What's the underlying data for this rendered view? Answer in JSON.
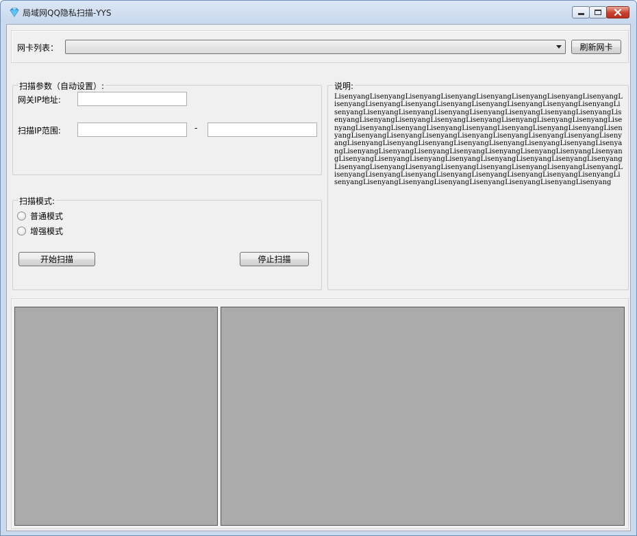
{
  "window": {
    "title": "局域网QQ隐私扫描-YYS"
  },
  "adapter": {
    "label": "网卡列表：",
    "selected": "",
    "refresh_button": "刷新网卡"
  },
  "scan_params": {
    "title": "扫描参数（自动设置）:",
    "gateway_label": "网关IP地址:",
    "gateway_value": "",
    "range_label": "扫描IP范围:",
    "range_start": "",
    "range_sep": "-",
    "range_end": ""
  },
  "scan_mode": {
    "title": "扫描模式:",
    "options": [
      "普通模式",
      "增强模式"
    ],
    "start_button": "开始扫描",
    "stop_button": "停止扫描"
  },
  "description": {
    "title": "说明:",
    "text": "LisenyangLisenyangLisenyangLisenyangLisenyangLisenyangLisenyangLisenyangLisenyangLisenyangLisenyangLisenyangLisenyangLisenyangLisenyangLisenyangLisenyangLisenyangLisenyangLisenyangLisenyangLisenyangLisenyangLisenyangLisenyangLisenyangLisenyangLisenyangLisenyangLisenyangLisenyangLisenyangLisenyangLisenyangLisenyangLisenyangLisenyangLisenyangLisenyangLisenyangLisenyangLisenyangLisenyangLisenyangLisenyangLisenyangLisenyangLisenyangLisenyangLisenyangLisenyangLisenyangLisenyangLisenyangLisenyangLisenyangLisenyangLisenyangLisenyangLisenyangLisenyangLisenyangLisenyangLisenyangLisenyangLisenyangLisenyangLisenyangLisenyangLisenyangLisenyangLisenyangLisenyangLisenyangLisenyangLisenyangLisenyangLisenyangLisenyangLisenyangLisenyangLisenyangLisenyangLisenyangLisenyangLisenyangLisenyangLisenyangLisenyangLisenyangLisenyangLisenyangLisenyangLisenyangLisenyangLisenyangLisenyang"
  },
  "colors": {
    "client_bg": "#f0f0f0",
    "pane_bg": "#ababab",
    "close_button": "#c7412b"
  }
}
